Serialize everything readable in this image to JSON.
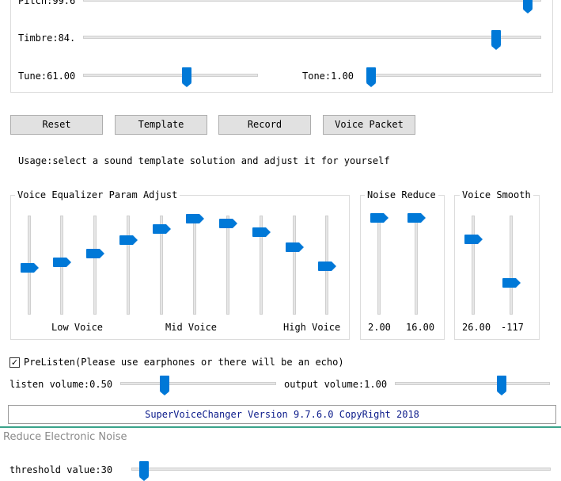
{
  "top_group": {
    "pitch_label": "Pitch:99.6",
    "timbre_label": "Timbre:84.",
    "tune_label": "Tune:61.00",
    "tone_label": "Tone:1.00",
    "pitch_level": 0.98,
    "timbre_level": 0.91,
    "tune_level": 0.6,
    "tone_level": 0.0
  },
  "buttons": {
    "reset": "Reset",
    "template": "Template",
    "record": "Record",
    "voice_packet": "Voice Packet"
  },
  "usage_text": "Usage:select a sound template solution and adjust it for yourself",
  "equalizer": {
    "title": "Voice Equalizer Param Adjust",
    "low_label": "Low Voice",
    "mid_label": "Mid Voice",
    "high_label": "High Voice",
    "levels": [
      0.47,
      0.53,
      0.62,
      0.76,
      0.88,
      0.98,
      0.93,
      0.84,
      0.69,
      0.49
    ]
  },
  "noise_reduce": {
    "title": "Noise Reduce",
    "value1": "2.00",
    "value2": "16.00",
    "levels": [
      0.99,
      0.99
    ]
  },
  "voice_smooth": {
    "title": "Voice Smooth",
    "value1": "26.00",
    "value2": "-117",
    "levels": [
      0.77,
      0.31
    ]
  },
  "prelisten": {
    "checked_glyph": "✓",
    "label": "PreListen(Please use earphones or there will be an echo)"
  },
  "volume": {
    "listen_label": "listen volume:0.50",
    "output_label": "output volume:1.00",
    "listen_level": 0.27,
    "output_level": 0.7
  },
  "footer_text": "SuperVoiceChanger Version 9.7.6.0 CopyRight 2018",
  "reduce_noise": {
    "title": "Reduce Electronic Noise",
    "threshold_label": "threshold value:30",
    "threshold_level": 0.02
  },
  "colors": {
    "accent": "#0078d7",
    "footer_text": "#0a1a8a",
    "divider": "#3aa38a"
  }
}
